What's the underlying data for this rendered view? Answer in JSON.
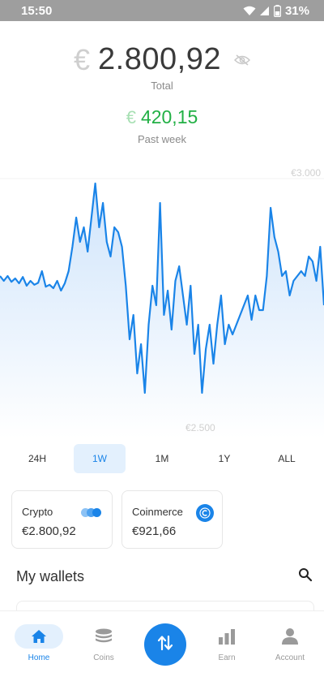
{
  "status_bar": {
    "time": "15:50",
    "battery": "31%"
  },
  "balance": {
    "currency": "€",
    "value": "2.800,92",
    "label": "Total"
  },
  "change": {
    "currency": "€",
    "value": "420,15",
    "label": "Past week"
  },
  "chart_data": {
    "type": "area",
    "title": "",
    "ylim": [
      2500,
      3000
    ],
    "y_tick_labels": [
      "€3.000",
      "€2.500"
    ],
    "values": [
      2800,
      2790,
      2800,
      2788,
      2795,
      2785,
      2798,
      2780,
      2790,
      2782,
      2786,
      2810,
      2778,
      2782,
      2775,
      2790,
      2770,
      2785,
      2810,
      2860,
      2920,
      2870,
      2900,
      2850,
      2920,
      2990,
      2900,
      2950,
      2870,
      2840,
      2900,
      2890,
      2860,
      2780,
      2670,
      2720,
      2600,
      2660,
      2560,
      2700,
      2780,
      2740,
      2950,
      2720,
      2770,
      2690,
      2790,
      2820,
      2760,
      2700,
      2780,
      2640,
      2700,
      2560,
      2650,
      2700,
      2620,
      2700,
      2760,
      2660,
      2700,
      2680,
      2700,
      2720,
      2740,
      2760,
      2710,
      2760,
      2730,
      2730,
      2800,
      2940,
      2880,
      2850,
      2800,
      2810,
      2760,
      2790,
      2800,
      2810,
      2800,
      2840,
      2830,
      2790,
      2860,
      2740
    ],
    "line_color": "#1a84e8",
    "fill_color": "#e3f0fd"
  },
  "range_tabs": [
    {
      "label": "24H",
      "active": false
    },
    {
      "label": "1W",
      "active": true
    },
    {
      "label": "1M",
      "active": false
    },
    {
      "label": "1Y",
      "active": false
    },
    {
      "label": "ALL",
      "active": false
    }
  ],
  "wallets": [
    {
      "name": "Crypto",
      "amount": "€2.800,92"
    },
    {
      "name": "Coinmerce",
      "amount": "€921,66"
    }
  ],
  "my_wallets": {
    "title": "My wallets"
  },
  "nav": {
    "home": "Home",
    "coins": "Coins",
    "earn": "Earn",
    "account": "Account"
  },
  "colors": {
    "accent": "#1a84e8",
    "positive": "#22b045"
  }
}
